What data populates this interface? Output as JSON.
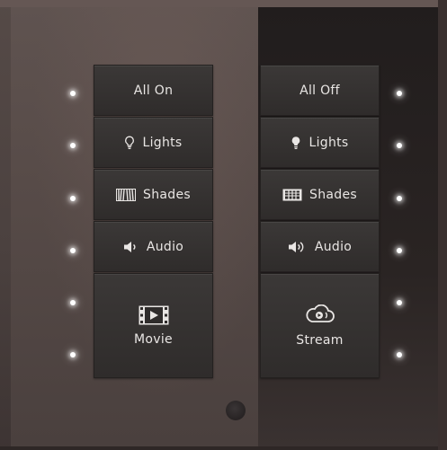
{
  "left_column": {
    "all": "All On",
    "lights": "Lights",
    "shades": "Shades",
    "audio": "Audio",
    "movie": "Movie"
  },
  "right_column": {
    "all": "All Off",
    "lights": "Lights",
    "shades": "Shades",
    "audio": "Audio",
    "stream": "Stream"
  },
  "icons": {
    "left_lights": "lightbulb-outline-icon",
    "right_lights": "lightbulb-filled-icon",
    "left_shades": "shades-open-icon",
    "right_shades": "shades-closed-icon",
    "left_audio": "speaker-icon",
    "right_audio": "speaker-sound-icon",
    "movie": "film-play-icon",
    "stream": "cloud-stream-icon"
  },
  "colors": {
    "button_face": "#353231",
    "button_text": "#e9e6e4",
    "led": "#ffffff"
  }
}
